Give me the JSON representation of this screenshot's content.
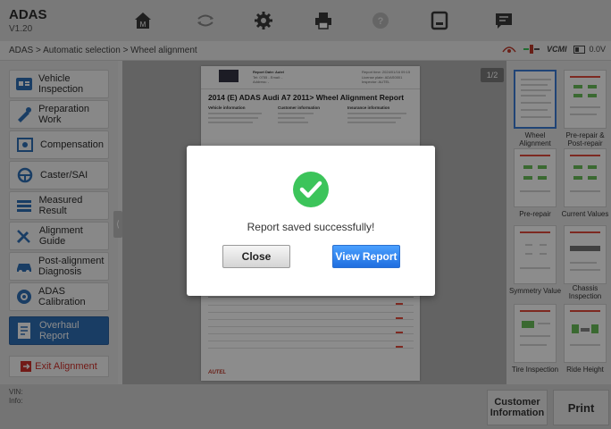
{
  "app": {
    "title": "ADAS",
    "version": "V1.20"
  },
  "toolbar": {
    "icons": [
      "home-icon",
      "vehicle-swap-icon",
      "gear-icon",
      "printer-icon",
      "help-icon",
      "save-icon",
      "message-icon"
    ]
  },
  "breadcrumb": "ADAS > Automatic selection > Wheel alignment",
  "status": {
    "vcmi_label": "VCMI",
    "battery_text": "0.0V"
  },
  "sidebar": {
    "items": [
      {
        "label": "Vehicle Inspection",
        "icon": "car-inspection-icon"
      },
      {
        "label": "Preparation Work",
        "icon": "tools-icon"
      },
      {
        "label": "Compensation",
        "icon": "compensation-icon"
      },
      {
        "label": "Caster/SAI",
        "icon": "steering-wheel-icon"
      },
      {
        "label": "Measured Result",
        "icon": "list-icon"
      },
      {
        "label": "Alignment Guide",
        "icon": "wrench-icon"
      },
      {
        "label": "Post-alignment Diagnosis",
        "icon": "car-icon"
      },
      {
        "label": "ADAS Calibration",
        "icon": "adas-icon"
      },
      {
        "label": "Overhaul Report",
        "icon": "report-icon",
        "active": true
      }
    ],
    "exit_label": "Exit Alignment"
  },
  "report": {
    "header_name": "Report Date: Autel",
    "header_lines": [
      "Tel: 0755 - Email: -",
      "Address: -"
    ],
    "header_right": [
      "Report time: 2024/01/16 09:15",
      "License plate: ADAS0001",
      "Inspector: AUTEL"
    ],
    "title": "2014 (E) ADAS Audi A7 2011> Wheel Alignment Report",
    "sections": [
      "Vehicle information",
      "Customer information",
      "Insurance information"
    ],
    "footer_logo": "AUTEL",
    "page_indicator": "1/2"
  },
  "thumbnails": [
    {
      "label": "Wheel Alignment",
      "selected": true
    },
    {
      "label": "Pre-repair & Post-repair"
    },
    {
      "label": "Pre-repair"
    },
    {
      "label": "Current Values"
    },
    {
      "label": "Symmetry Value"
    },
    {
      "label": "Chassis Inspection"
    },
    {
      "label": "Tire Inspection"
    },
    {
      "label": "Ride Height"
    }
  ],
  "bottom": {
    "vin_label": "VIN:",
    "info_label": "Info:",
    "customer_info_label": "Customer Information",
    "print_label": "Print"
  },
  "dialog": {
    "message": "Report saved successfully!",
    "close_label": "Close",
    "view_label": "View Report"
  },
  "colors": {
    "accent": "#2f6fb6",
    "success": "#3cc45a",
    "exit_red": "#d0302a",
    "view_button": "#1f6ee0"
  }
}
